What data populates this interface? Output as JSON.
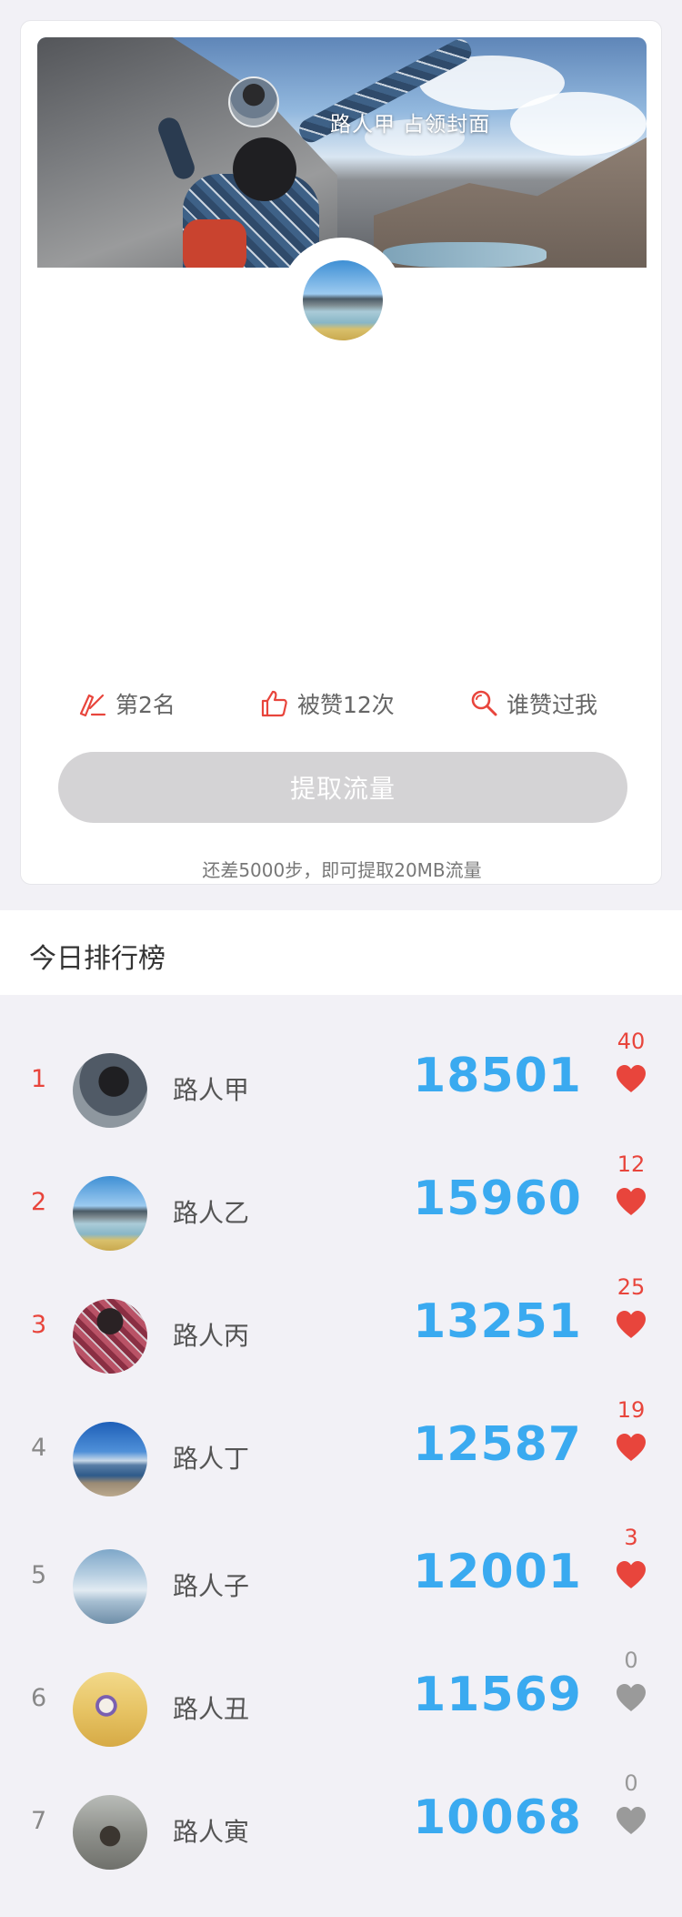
{
  "cover": {
    "owner_text": "路人甲 占领封面"
  },
  "stats": {
    "rank_label": "第2名",
    "liked_label": "被赞12次",
    "who_liked_label": "谁赞过我"
  },
  "extract_button_label": "提取流量",
  "hint_text": "还差5000步，即可提取20MB流量",
  "leaderboard": {
    "title": "今日排行榜",
    "rows": [
      {
        "rank": "1",
        "name": "路人甲",
        "steps": "18501",
        "likes": "40",
        "liked": true
      },
      {
        "rank": "2",
        "name": "路人乙",
        "steps": "15960",
        "likes": "12",
        "liked": true
      },
      {
        "rank": "3",
        "name": "路人丙",
        "steps": "13251",
        "likes": "25",
        "liked": true
      },
      {
        "rank": "4",
        "name": "路人丁",
        "steps": "12587",
        "likes": "19",
        "liked": true
      },
      {
        "rank": "5",
        "name": "路人子",
        "steps": "12001",
        "likes": "3",
        "liked": true
      },
      {
        "rank": "6",
        "name": "路人丑",
        "steps": "11569",
        "likes": "0",
        "liked": false
      },
      {
        "rank": "7",
        "name": "路人寅",
        "steps": "10068",
        "likes": "0",
        "liked": false
      }
    ]
  },
  "colors": {
    "accent_red": "#e8453c",
    "step_blue": "#3aaaf0",
    "heart_gray": "#9a9a9a",
    "disabled_button": "#d4d3d5"
  },
  "icons": {
    "rank": "pen-ranking-icon",
    "liked": "thumbs-up-icon",
    "who_liked": "search-icon",
    "like": "heart-icon"
  }
}
